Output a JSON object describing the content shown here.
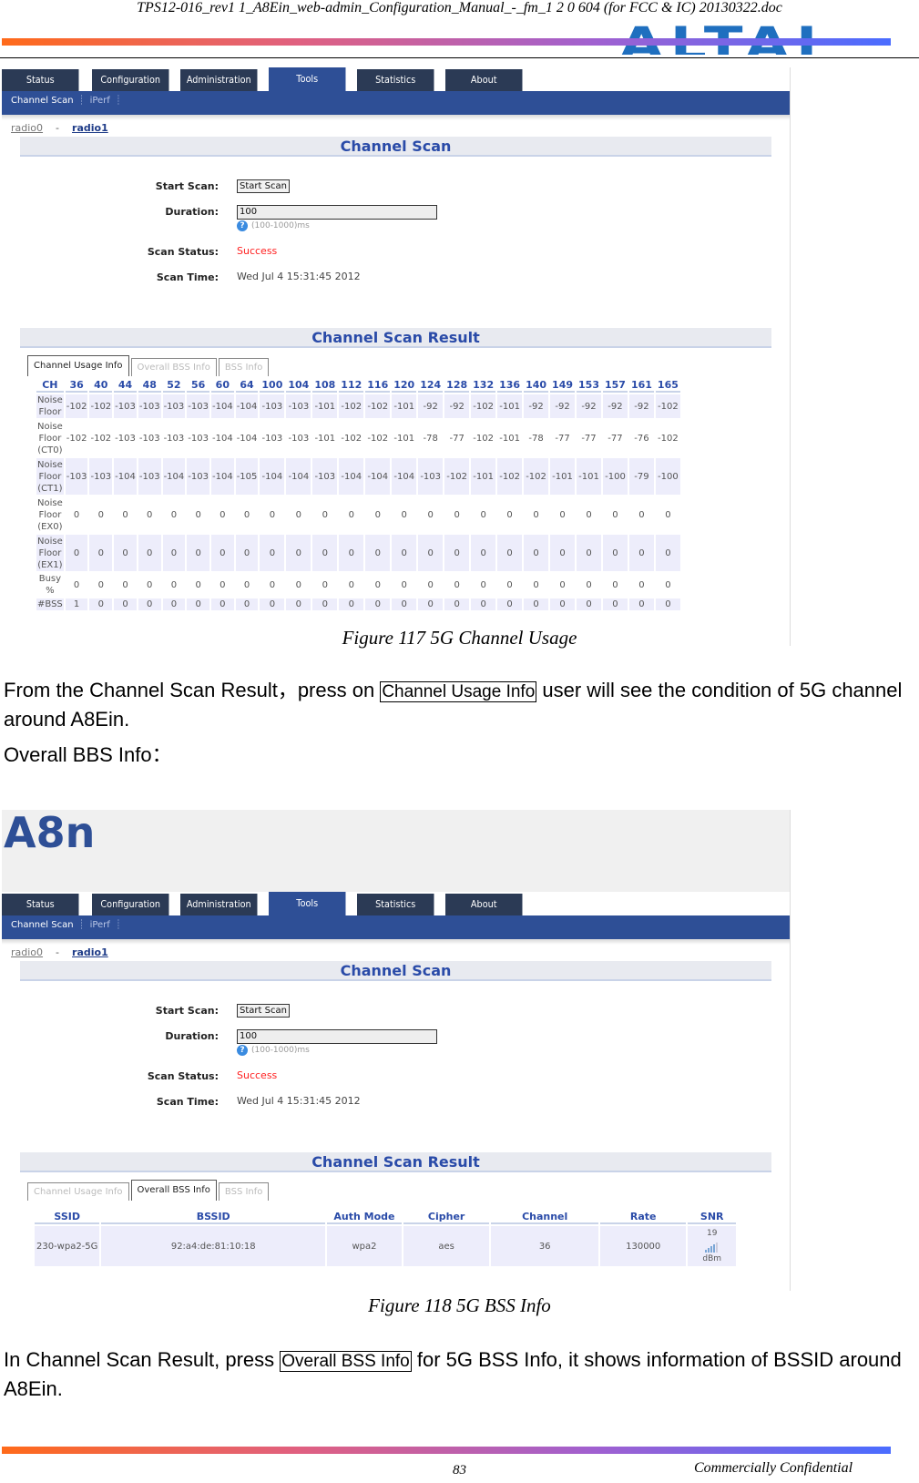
{
  "doc": {
    "header_title": "TPS12-016_rev1 1_A8Ein_web-admin_Configuration_Manual_-_fm_1 2 0 604 (for FCC & IC) 20130322.doc",
    "logo_text": "ALTAI",
    "page_number": "83",
    "footer_text": "Commercially Confidential",
    "accent_gradient": [
      "#ff6a1a",
      "#e06080",
      "#a060d0",
      "#4a6cff"
    ]
  },
  "ui": {
    "brand": "A8n",
    "nav_tabs": [
      "Status",
      "Configuration",
      "Administration",
      "Tools",
      "Statistics",
      "About"
    ],
    "active_tab": "Tools",
    "subnav": [
      "Channel Scan",
      "iPerf"
    ],
    "radio_links": [
      "radio0",
      "radio1"
    ],
    "radio_separator": "-",
    "section_channel_scan": "Channel Scan",
    "labels": {
      "start_scan": "Start Scan:",
      "duration": "Duration:",
      "scan_status": "Scan Status:",
      "scan_time": "Scan Time:"
    },
    "start_scan_button": "Start Scan",
    "duration_value": "100",
    "duration_hint": "(100-1000)ms",
    "help_icon": "?",
    "scan_status": "Success",
    "scan_time": "Wed Jul 4 15:31:45 2012",
    "section_result": "Channel Scan Result",
    "result_tabs": [
      "Channel Usage Info",
      "Overall BSS Info",
      "BSS Info"
    ],
    "colors": {
      "nav_dark": "#2b3a55",
      "nav_blue": "#2e4f96",
      "title_blue": "#2a4ba8",
      "success_red": "#ff2020"
    }
  },
  "figure1": {
    "caption": "Figure 117 5G Channel Usage",
    "active_result_tab": 0,
    "usage": {
      "header_label": "CH",
      "channels": [
        "36",
        "40",
        "44",
        "48",
        "52",
        "56",
        "60",
        "64",
        "100",
        "104",
        "108",
        "112",
        "116",
        "120",
        "124",
        "128",
        "132",
        "136",
        "140",
        "149",
        "153",
        "157",
        "161",
        "165"
      ],
      "rows": [
        {
          "label": [
            "Noise",
            "Floor"
          ],
          "values": [
            "-102",
            "-102",
            "-103",
            "-103",
            "-103",
            "-103",
            "-104",
            "-104",
            "-103",
            "-103",
            "-101",
            "-102",
            "-102",
            "-101",
            "-92",
            "-92",
            "-102",
            "-101",
            "-92",
            "-92",
            "-92",
            "-92",
            "-92",
            "-102"
          ]
        },
        {
          "label": [
            "Noise",
            "Floor",
            "(CT0)"
          ],
          "values": [
            "-102",
            "-102",
            "-103",
            "-103",
            "-103",
            "-103",
            "-104",
            "-104",
            "-103",
            "-103",
            "-101",
            "-102",
            "-102",
            "-101",
            "-78",
            "-77",
            "-102",
            "-101",
            "-78",
            "-77",
            "-77",
            "-77",
            "-76",
            "-102"
          ]
        },
        {
          "label": [
            "Noise",
            "Floor",
            "(CT1)"
          ],
          "values": [
            "-103",
            "-103",
            "-104",
            "-103",
            "-104",
            "-103",
            "-104",
            "-105",
            "-104",
            "-104",
            "-103",
            "-104",
            "-104",
            "-104",
            "-103",
            "-102",
            "-101",
            "-102",
            "-102",
            "-101",
            "-101",
            "-100",
            "-79",
            "-100"
          ]
        },
        {
          "label": [
            "Noise",
            "Floor",
            "(EX0)"
          ],
          "values": [
            "0",
            "0",
            "0",
            "0",
            "0",
            "0",
            "0",
            "0",
            "0",
            "0",
            "0",
            "0",
            "0",
            "0",
            "0",
            "0",
            "0",
            "0",
            "0",
            "0",
            "0",
            "0",
            "0",
            "0"
          ]
        },
        {
          "label": [
            "Noise",
            "Floor",
            "(EX1)"
          ],
          "values": [
            "0",
            "0",
            "0",
            "0",
            "0",
            "0",
            "0",
            "0",
            "0",
            "0",
            "0",
            "0",
            "0",
            "0",
            "0",
            "0",
            "0",
            "0",
            "0",
            "0",
            "0",
            "0",
            "0",
            "0"
          ]
        },
        {
          "label": [
            "Busy",
            "%"
          ],
          "values": [
            "0",
            "0",
            "0",
            "0",
            "0",
            "0",
            "0",
            "0",
            "0",
            "0",
            "0",
            "0",
            "0",
            "0",
            "0",
            "0",
            "0",
            "0",
            "0",
            "0",
            "0",
            "0",
            "0",
            "0"
          ]
        },
        {
          "label": [
            "#BSS"
          ],
          "values": [
            "1",
            "0",
            "0",
            "0",
            "0",
            "0",
            "0",
            "0",
            "0",
            "0",
            "0",
            "0",
            "0",
            "0",
            "0",
            "0",
            "0",
            "0",
            "0",
            "0",
            "0",
            "0",
            "0",
            "0"
          ]
        }
      ]
    }
  },
  "para1": {
    "before": "From the Channel Scan Result，press on ",
    "boxed": "Channel Usage Info",
    "after": " user will see the condition of 5G channel around A8Ein."
  },
  "para2": "Overall BBS Info：",
  "figure2": {
    "caption": "Figure 118 5G BSS Info",
    "active_result_tab": 1,
    "bss": {
      "headers": [
        "SSID",
        "BSSID",
        "Auth Mode",
        "Cipher",
        "Channel",
        "Rate",
        "SNR"
      ],
      "rows": [
        {
          "ssid": "230-wpa2-5G",
          "bssid": "92:a4:de:81:10:18",
          "auth": "wpa2",
          "cipher": "aes",
          "channel": "36",
          "rate": "130000",
          "snr_value": "19",
          "snr_unit": "dBm",
          "signal_level": "4 of 5 bars"
        }
      ]
    }
  },
  "para3": {
    "before": "In Channel Scan Result, press ",
    "boxed": "Overall BSS Info",
    "after": " for 5G BSS Info, it shows information of BSSID around A8Ein."
  }
}
